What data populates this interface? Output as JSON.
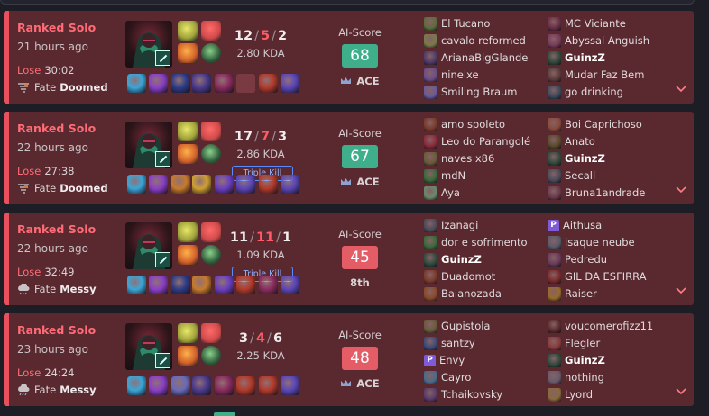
{
  "matches": [
    {
      "queue": "Ranked Solo",
      "time_ago": "21 hours ago",
      "result": "Lose",
      "duration": "30:02",
      "fate_label": "Fate",
      "fate_value": "Doomed",
      "fate_icon": "tornado-icon",
      "kills": "12",
      "deaths": "5",
      "assists": "2",
      "kda": "2.80 KDA",
      "badge": "",
      "ai_label": "AI-Score",
      "ai_score": "68",
      "score_color": "#3fae8b",
      "rank_label": "ACE",
      "rank_icon": "crown-icon",
      "items": [
        "#3aa6d8",
        "#8a3fc7",
        "#2c3b86",
        "#4b3a8c",
        "#8a2b5e",
        "#6c2d34",
        "#b23a2a",
        "#5b46b8"
      ],
      "left_team": [
        "El Tucano",
        "cavalo reformed",
        "ArianaBigGlande",
        "ninelxe",
        "Smiling Braum"
      ],
      "right_team": [
        "MC Viciante",
        "Abyssal Anguish",
        "GuinzZ",
        "Mudar Faz Bem",
        "go drinking"
      ],
      "me_side": "right",
      "me_index": 2,
      "premium": [],
      "left_colors": [
        "#5e6c3a",
        "#7a7a4a",
        "#4e3a6a",
        "#6a4d8a",
        "#6a5a9a"
      ],
      "right_colors": [
        "#6a2d45",
        "#7a3a5a",
        "#2f4a3d",
        "#5a3d3a",
        "#3a4a5a"
      ]
    },
    {
      "queue": "Ranked Solo",
      "time_ago": "22 hours ago",
      "result": "Lose",
      "duration": "27:38",
      "fate_label": "Fate",
      "fate_value": "Doomed",
      "fate_icon": "tornado-icon",
      "kills": "17",
      "deaths": "7",
      "assists": "3",
      "kda": "2.86 KDA",
      "badge": "Triple Kill",
      "ai_label": "AI-Score",
      "ai_score": "67",
      "score_color": "#3fae8b",
      "rank_label": "ACE",
      "rank_icon": "crown-icon",
      "items": [
        "#3aa6d8",
        "#8a3fc7",
        "#c77a2a",
        "#d0a030",
        "#6a3fc0",
        "#5b46b8",
        "#b23a2a",
        "#5b46b8"
      ],
      "left_team": [
        "amo spoleto",
        "Leo do Parangolé",
        "naves x86",
        "mdN",
        "Aya"
      ],
      "right_team": [
        "Boi Caprichoso",
        "Anato",
        "GuinzZ",
        "Secall",
        "Bruna1andrade"
      ],
      "me_side": "right",
      "me_index": 2,
      "premium": [],
      "left_colors": [
        "#7a3a2a",
        "#8a2a3a",
        "#6a5a3a",
        "#3a6a3a",
        "#6a8a6a"
      ],
      "right_colors": [
        "#8a4a3a",
        "#5a4a2a",
        "#2f4a3d",
        "#4a4a5a",
        "#6a3a4a"
      ]
    },
    {
      "queue": "Ranked Solo",
      "time_ago": "22 hours ago",
      "result": "Lose",
      "duration": "32:49",
      "fate_label": "Fate",
      "fate_value": "Messy",
      "fate_icon": "cloud-icon",
      "kills": "11",
      "deaths": "11",
      "assists": "1",
      "kda": "1.09 KDA",
      "badge": "Triple Kill",
      "ai_label": "AI-Score",
      "ai_score": "45",
      "score_color": "#e45c66",
      "rank_label": "8th",
      "rank_icon": "",
      "items": [
        "#3aa6d8",
        "#8a3fc7",
        "#2c3b86",
        "#c77a2a",
        "#6a3fc0",
        "#b23a2a",
        "#8a2b5e",
        "#5b46b8"
      ],
      "left_team": [
        "Izanagi",
        "dor e sofrimento",
        "GuinzZ",
        "Duadomot",
        "Baianozada"
      ],
      "right_team": [
        "Aithusa",
        "isaque neube",
        "Pedredu",
        "GIL DA ESFIRRA",
        "Raiser"
      ],
      "me_side": "left",
      "me_index": 2,
      "premium": [
        "right-0"
      ],
      "left_colors": [
        "#4a4a5a",
        "#3a6a3a",
        "#2f4a3d",
        "#7a3a2a",
        "#8a4a2a"
      ],
      "right_colors": [
        "#7f5bd8",
        "#5a5a6a",
        "#6a3a5a",
        "#7a2a2a",
        "#9a6a2a"
      ]
    },
    {
      "queue": "Ranked Solo",
      "time_ago": "23 hours ago",
      "result": "Lose",
      "duration": "24:24",
      "fate_label": "Fate",
      "fate_value": "Messy",
      "fate_icon": "cloud-icon",
      "kills": "3",
      "deaths": "4",
      "assists": "6",
      "kda": "2.25 KDA",
      "badge": "",
      "ai_label": "AI-Score",
      "ai_score": "48",
      "score_color": "#e45c66",
      "rank_label": "ACE",
      "rank_icon": "crown-icon",
      "items": [
        "#3aa6d8",
        "#8a3fc7",
        "#6a6ab8",
        "#4b3a8c",
        "#8a2b5e",
        "#b23a2a",
        "#b23a2a",
        "#5b46b8"
      ],
      "left_team": [
        "Gupistola",
        "santzy",
        "Envy",
        "Cayro",
        "Tchaikovsky"
      ],
      "right_team": [
        "voucomerofizz11",
        "Flegler",
        "GuinzZ",
        "nothing",
        "Lyord"
      ],
      "me_side": "right",
      "me_index": 2,
      "premium": [
        "left-2"
      ],
      "left_colors": [
        "#6a5a3a",
        "#3a4a7a",
        "#7f5bd8",
        "#4a6a8a",
        "#5a3a6a"
      ],
      "right_colors": [
        "#5a2a2a",
        "#8a3a3a",
        "#2f4a3d",
        "#6a5a6a",
        "#8a6a3a"
      ]
    }
  ],
  "champion": {
    "name_icon": "akali-champion-icon",
    "spells": [
      "yellow-spell",
      "red-spell",
      "orange-rune",
      "green-rune"
    ]
  },
  "expand_icon": "chevron-down-icon"
}
